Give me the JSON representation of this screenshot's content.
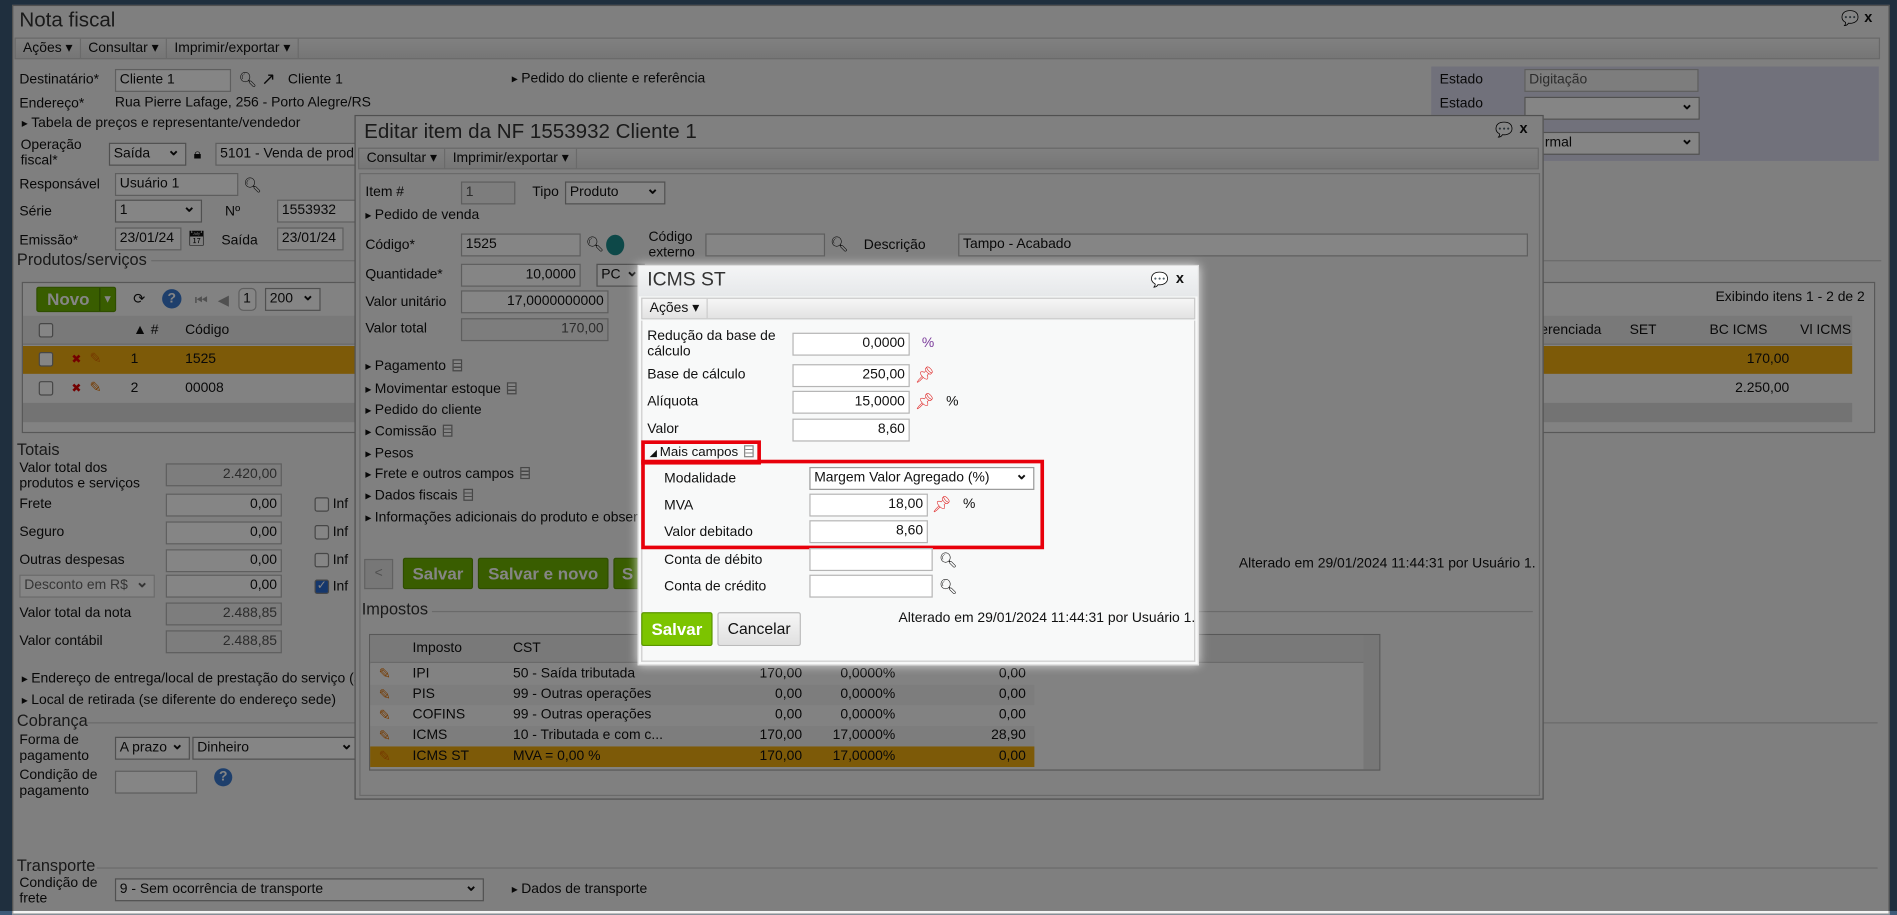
{
  "main": {
    "title": "Nota fiscal",
    "menu": [
      "Ações ▾",
      "Consultar ▾",
      "Imprimir/exportar ▾"
    ],
    "destinatario_label": "Destinatário*",
    "destinatario_value": "Cliente 1",
    "destinatario_link": "Cliente 1",
    "pedido_cliente_ref": "Pedido do cliente e referência",
    "endereco_label": "Endereço*",
    "endereco_value": "Rua Pierre Lafage, 256 - Porto Alegre/RS",
    "tabela_precos": "Tabela de preços e representante/vendedor",
    "operacao_label": "Operação fiscal*",
    "operacao_tipo": "Saída",
    "operacao_value": "5101 - Venda de prod",
    "responsavel_label": "Responsável",
    "responsavel_value": "Usuário 1",
    "serie_label": "Série",
    "serie_value": "1",
    "numero_label": "Nº",
    "numero_value": "1553932",
    "emissao_label": "Emissão*",
    "emissao_value": "23/01/24",
    "saida_label": "Saída",
    "saida_value": "23/01/24",
    "estado_label": "Estado",
    "estado_value": "Digitação",
    "estado2_label": "Estado",
    "estado3_value": "rmal",
    "produtos": {
      "title": "Produtos/serviços",
      "novo": "Novo",
      "page": "1",
      "page_size": "200",
      "summary": "Exibindo itens 1 - 2 de 2",
      "columns": [
        "▲ #",
        "Código",
        "ferenciada",
        "SET",
        "BC ICMS",
        "Vl ICMS"
      ],
      "rows": [
        {
          "num": "1",
          "codigo": "1525",
          "bc_icms": "170,00"
        },
        {
          "num": "2",
          "codigo": "00008",
          "bc_icms": "2.250,00"
        }
      ]
    },
    "totais": {
      "title": "Totais",
      "vt_produtos_label": "Valor total dos produtos e serviços",
      "vt_produtos": "2.420,00",
      "frete_label": "Frete",
      "frete": "0,00",
      "seguro_label": "Seguro",
      "seguro": "0,00",
      "outras_label": "Outras despesas",
      "outras": "0,00",
      "desconto_select": "Desconto em R$",
      "desconto": "0,00",
      "inf": "Inf",
      "vt_nota_label": "Valor total da nota",
      "vt_nota": "2.488,85",
      "contabil_label": "Valor contábil",
      "contabil": "2.488,85"
    },
    "endereco_entrega": "Endereço de entrega/local de prestação do serviço (s",
    "local_retirada": "Local de retirada (se diferente do endereço sede)",
    "cobranca": {
      "title": "Cobrança",
      "forma_label": "Forma de pagamento",
      "forma_value": "A prazo",
      "forma_meio": "Dinheiro",
      "condicao_label": "Condição de pagamento"
    },
    "transporte": {
      "title": "Transporte",
      "frete_label": "Condição de frete",
      "frete_value": "9 - Sem ocorrência de transporte",
      "dados": "Dados de transporte"
    }
  },
  "edit": {
    "title": "Editar item da NF 1553932 Cliente 1",
    "menu": [
      "Consultar ▾",
      "Imprimir/exportar ▾"
    ],
    "item_label": "Item #",
    "item_value": "1",
    "tipo_label": "Tipo",
    "tipo_value": "Produto",
    "pedido_venda": "Pedido de venda",
    "codigo_label": "Código*",
    "codigo_value": "1525",
    "codigo_externo_label": "Código externo",
    "descricao_label": "Descrição",
    "descricao_value": "Tampo - Acabado",
    "quantidade_label": "Quantidade*",
    "quantidade_value": "10,0000",
    "unidade": "PC",
    "valor_unitario_label": "Valor unitário",
    "valor_unitario": "17,0000000000",
    "valor_total_label": "Valor total",
    "valor_total": "170,00",
    "sections": [
      "Pagamento",
      "Movimentar estoque",
      "Pedido do cliente",
      "Comissão",
      "Pesos",
      "Frete e outros campos",
      "Dados fiscais",
      "Informações adicionais do produto e obser"
    ],
    "btn_prev": "<",
    "btn_salvar": "Salvar",
    "btn_salvar_novo": "Salvar e novo",
    "btn_s": "S",
    "alterado": "Alterado em 29/01/2024 11:44:31 por Usuário 1.",
    "impostos": {
      "title": "Impostos",
      "columns": [
        "Imposto",
        "CST"
      ],
      "rows": [
        {
          "imposto": "IPI",
          "cst": "50 - Saída tributada",
          "base": "170,00",
          "aliq": "0,0000%",
          "valor": "0,00"
        },
        {
          "imposto": "PIS",
          "cst": "99 - Outras operações",
          "base": "0,00",
          "aliq": "0,0000%",
          "valor": "0,00"
        },
        {
          "imposto": "COFINS",
          "cst": "99 - Outras operações",
          "base": "0,00",
          "aliq": "0,0000%",
          "valor": "0,00"
        },
        {
          "imposto": "ICMS",
          "cst": "10 - Tributada e com c...",
          "base": "170,00",
          "aliq": "17,0000%",
          "valor": "28,90"
        },
        {
          "imposto": "ICMS ST",
          "cst": "MVA = 0,00 %",
          "base": "170,00",
          "aliq": "17,0000%",
          "valor": "0,00"
        }
      ]
    }
  },
  "icms": {
    "title": "ICMS ST",
    "menu": "Ações ▾",
    "reducao_label": "Redução da base de cálculo",
    "reducao": "0,0000",
    "pct": "%",
    "base_label": "Base de cálculo",
    "base": "250,00",
    "aliquota_label": "Alíquota",
    "aliquota": "15,0000",
    "valor_label": "Valor",
    "valor": "8,60",
    "mais_campos": "Mais campos",
    "modalidade_label": "Modalidade",
    "modalidade": "Margem Valor Agregado (%)",
    "mva_label": "MVA",
    "mva": "18,00",
    "valor_debitado_label": "Valor debitado",
    "valor_debitado": "8,60",
    "conta_debito_label": "Conta de débito",
    "conta_credito_label": "Conta de crédito",
    "salvar": "Salvar",
    "cancelar": "Cancelar",
    "alterado": "Alterado em 29/01/2024 11:44:31 por Usuário 1."
  },
  "colors": {
    "accent_green": "#6db300",
    "selected_row": "#f0ac10",
    "highlight": "#e8000b"
  }
}
